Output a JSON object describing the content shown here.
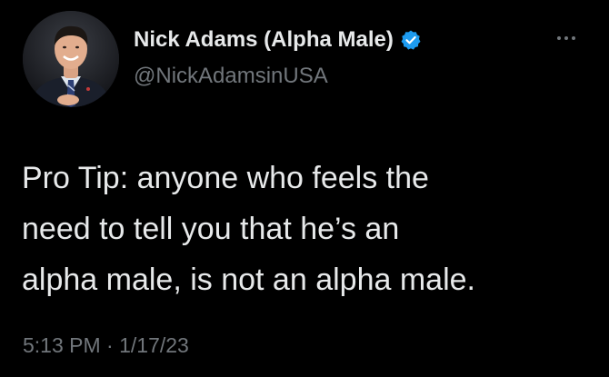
{
  "author": {
    "display_name": "Nick Adams (Alpha Male)",
    "handle": "@NickAdamsinUSA",
    "verified": true,
    "avatar_icon": "profile-photo",
    "verified_icon": "verified-badge-icon",
    "verified_color": "#1d9bf0"
  },
  "tweet": {
    "lines": [
      "Pro Tip: anyone who feels the",
      "need to tell you that he’s an",
      "alpha male, is not an alpha male."
    ],
    "time": "5:13 PM",
    "separator": "·",
    "date": "1/17/23"
  },
  "menu": {
    "icon": "more-options-icon"
  },
  "colors": {
    "background": "#000000",
    "primary_text": "#e7e9ea",
    "secondary_text": "#71767b"
  }
}
